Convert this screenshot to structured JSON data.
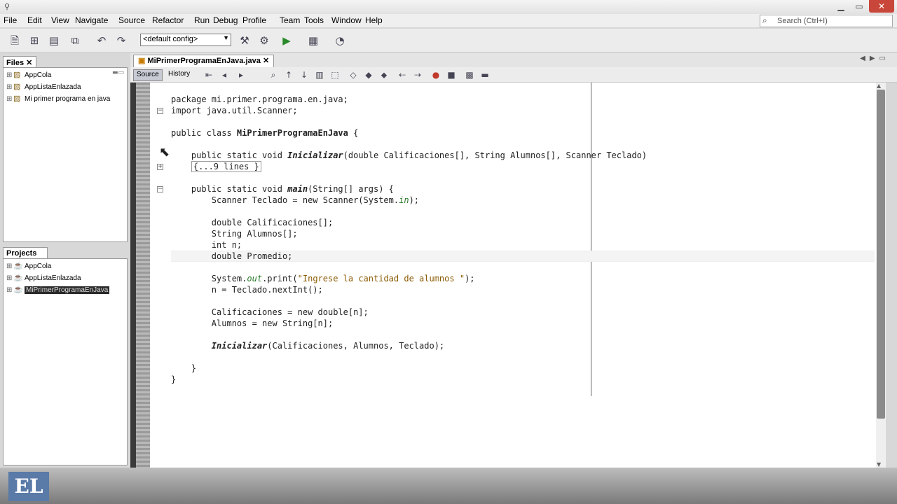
{
  "menu": [
    "File",
    "Edit",
    "View",
    "Navigate",
    "Source",
    "Refactor",
    "Run",
    "Debug",
    "Profile",
    "Team",
    "Tools",
    "Window",
    "Help"
  ],
  "search": {
    "placeholder": "Search (Ctrl+I)"
  },
  "toolbar": {
    "config": "<default config>"
  },
  "files_panel": {
    "title": "Files",
    "items": [
      {
        "label": "AppCola"
      },
      {
        "label": "AppListaEnlazada"
      },
      {
        "label": "Mi primer programa en java"
      }
    ]
  },
  "projects_panel": {
    "title": "Projects",
    "items": [
      {
        "label": "AppCola"
      },
      {
        "label": "AppListaEnlazada"
      },
      {
        "label": "MiPrimerProgramaEnJava",
        "selected": true
      }
    ]
  },
  "editor": {
    "tab_label": "MiPrimerProgramaEnJava.java",
    "source_label": "Source",
    "history_label": "History",
    "lines": {
      "l1": "package mi.primer.programa.en.java;",
      "l2": "import java.util.Scanner;",
      "l3a": "public class ",
      "l3b": "MiPrimerProgramaEnJava",
      "l3c": " {",
      "l4a": "    public static void ",
      "l4b": "Inicializar",
      "l4c": "(double Calificaciones[], String Alumnos[], Scanner Teclado)",
      "l5": "{...9 lines }",
      "l6a": "    public static void ",
      "l6b": "main",
      "l6c": "(String[] args) {",
      "l7a": "        Scanner Teclado = new Scanner(System.",
      "l7b": "in",
      "l7c": ");",
      "l8": "        double Calificaciones[];",
      "l9": "        String Alumnos[];",
      "l10": "        int n;",
      "l11": "        double Promedio;",
      "l12a": "        System.",
      "l12b": "out",
      "l12c": ".print(",
      "l12d": "\"Ingrese la cantidad de alumnos \"",
      "l12e": ");",
      "l13": "        n = Teclado.nextInt();",
      "l14": "        Calificaciones = new double[n];",
      "l15": "        Alumnos = new String[n];",
      "l16a": "        ",
      "l16b": "Inicializar",
      "l16c": "(Calificaciones, Alumnos, Teclado);",
      "l17": "    }",
      "l18": "}"
    }
  },
  "watermark": "EL"
}
